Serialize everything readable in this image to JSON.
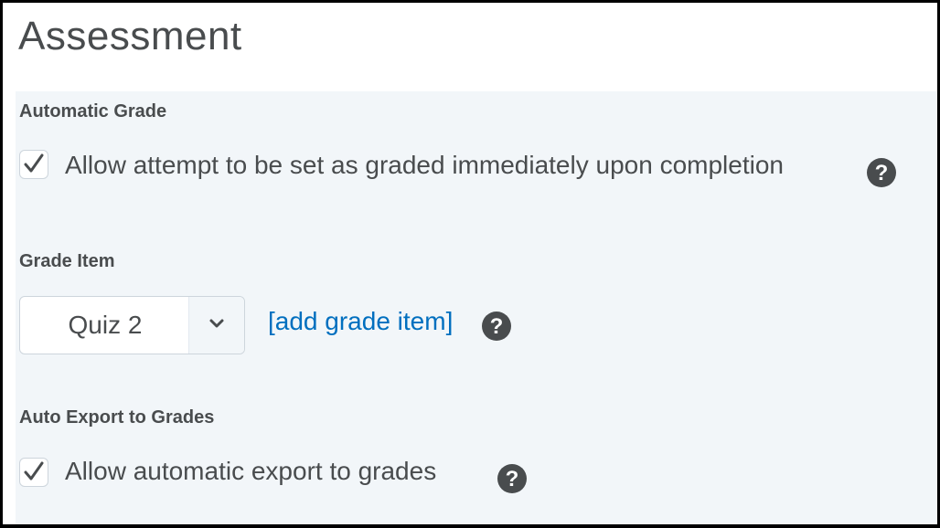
{
  "page": {
    "title": "Assessment"
  },
  "automatic_grade": {
    "label": "Automatic Grade",
    "checkbox_label": "Allow attempt to be set as graded immediately upon completion",
    "checked": true,
    "help_icon": "question-circle-icon"
  },
  "grade_item": {
    "label": "Grade Item",
    "selected_value": "Quiz 2",
    "toggle_icon": "chevron-down-icon",
    "add_link": "[add grade item]",
    "help_icon": "question-circle-icon"
  },
  "auto_export": {
    "label": "Auto Export to Grades",
    "checkbox_label": "Allow automatic export to grades",
    "checked": true,
    "help_icon": "question-circle-icon"
  },
  "colors": {
    "text": "#494c4e",
    "panel_bg": "#f2f6f9",
    "link": "#006fbf",
    "border": "#cdd5dc"
  }
}
